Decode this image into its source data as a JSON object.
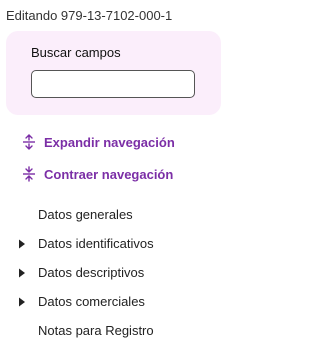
{
  "header": {
    "title": "Editando 979-13-7102-000-1"
  },
  "search": {
    "label": "Buscar campos",
    "value": "",
    "placeholder": ""
  },
  "nav_actions": {
    "expand_label": "Expandir navegación",
    "collapse_label": "Contraer navegación",
    "icon_color": "#7b2ea6"
  },
  "tree": {
    "items": [
      {
        "label": "Datos generales",
        "expandable": false
      },
      {
        "label": "Datos identificativos",
        "expandable": true
      },
      {
        "label": "Datos descriptivos",
        "expandable": true
      },
      {
        "label": "Datos comerciales",
        "expandable": true
      },
      {
        "label": "Notas para Registro",
        "expandable": false
      }
    ]
  },
  "colors": {
    "accent": "#7b2ea6",
    "card_background": "#fbeefb"
  }
}
